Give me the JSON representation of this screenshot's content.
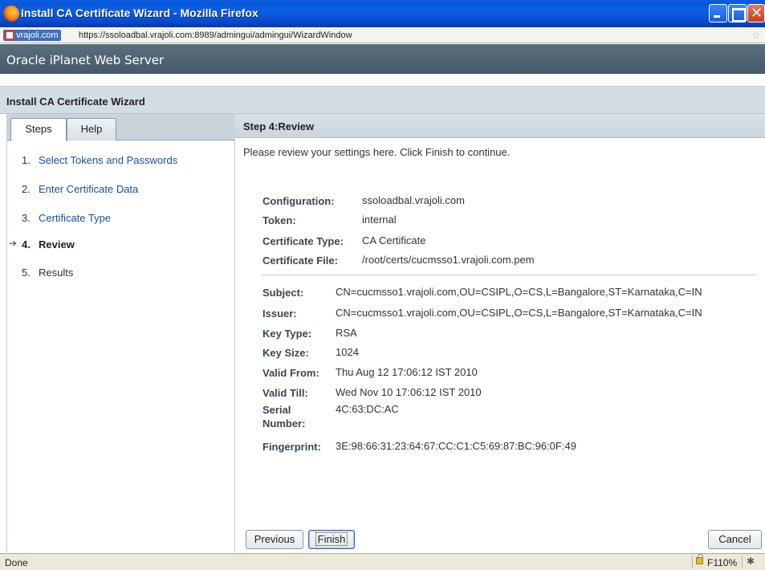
{
  "window": {
    "title": "Install CA Certificate Wizard - Mozilla Firefox",
    "site_label": "vrajoli.com",
    "url": "https://ssoloadbal.vrajoli.com:8989/admingui/admingui/WizardWindow"
  },
  "app": {
    "name": "Oracle iPlanet Web Server",
    "wizard_title": "Install CA Certificate Wizard"
  },
  "tabs": [
    {
      "label": "Steps",
      "active": true
    },
    {
      "label": "Help",
      "active": false
    }
  ],
  "steps": [
    {
      "num": "1.",
      "label": "Select Tokens and Passwords",
      "state": "link"
    },
    {
      "num": "2.",
      "label": "Enter Certificate Data",
      "state": "link"
    },
    {
      "num": "3.",
      "label": "Certificate Type",
      "state": "link"
    },
    {
      "num": "4.",
      "label": "Review",
      "state": "current"
    },
    {
      "num": "5.",
      "label": "Results",
      "state": "plain"
    }
  ],
  "step_header": "Step 4:Review",
  "instructions": "Please review your settings here. Click Finish to continue.",
  "settings": [
    {
      "key": "Configuration:",
      "value": "ssoloadbal.vrajoli.com"
    },
    {
      "key": "Token:",
      "value": "internal"
    },
    {
      "key": "Certificate Type:",
      "value": "CA Certificate"
    },
    {
      "key": "Certificate File:",
      "value": "/root/certs/cucmsso1.vrajoli.com.pem"
    }
  ],
  "certificate": [
    {
      "key": "Subject:",
      "value": "CN=cucmsso1.vrajoli.com,OU=CSIPL,O=CS,L=Bangalore,ST=Karnataka,C=IN"
    },
    {
      "key": "Issuer:",
      "value": "CN=cucmsso1.vrajoli.com,OU=CSIPL,O=CS,L=Bangalore,ST=Karnataka,C=IN"
    },
    {
      "key": "Key Type:",
      "value": "RSA"
    },
    {
      "key": "Key Size:",
      "value": "1024"
    },
    {
      "key": "Valid From:",
      "value": "Thu Aug 12 17:06:12 IST 2010"
    },
    {
      "key": "Valid Till:",
      "value": "Wed Nov 10 17:06:12 IST 2010"
    },
    {
      "key_line1": "Serial",
      "key_line2": "Number:",
      "value": "4C:63:DC:AC"
    },
    {
      "key": "Fingerprint:",
      "value": "3E:98:66:31:23:64:67:CC:C1:C5:69:87:BC:96:0F:49"
    }
  ],
  "buttons": {
    "previous": "Previous",
    "finish": "Finish",
    "cancel": "Cancel"
  },
  "status": {
    "text": "Done",
    "zoom": "F110%"
  },
  "colors": {
    "titlebar": "#0858d8",
    "app_header": "#4f6172",
    "link": "#1a4f98"
  }
}
